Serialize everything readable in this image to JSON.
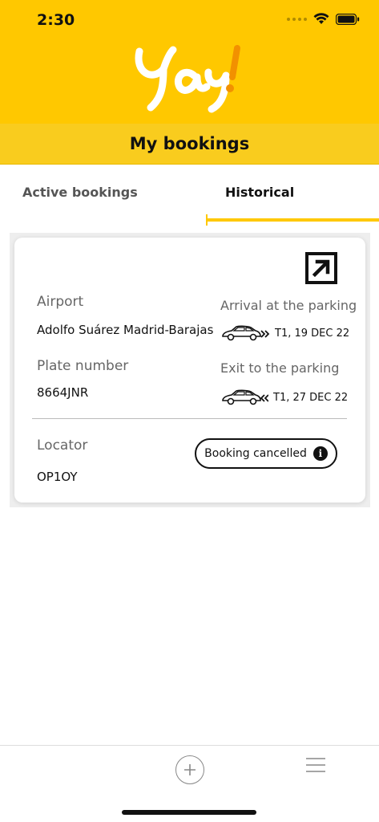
{
  "status_bar": {
    "time": "2:30"
  },
  "brand": {
    "name": "Yay!",
    "accent_color": "#FFC800"
  },
  "header": {
    "title": "My bookings"
  },
  "tabs": [
    {
      "label": "Active bookings",
      "selected": false
    },
    {
      "label": "Historical",
      "selected": true
    }
  ],
  "booking": {
    "airport_label": "Airport",
    "airport_value": "Adolfo Suárez Madrid-Barajas",
    "plate_label": "Plate number",
    "plate_value": "8664JNR",
    "locator_label": "Locator",
    "locator_value": "OP1OY",
    "arrival_label": "Arrival at the parking",
    "arrival_value": "T1, 19 DEC 22",
    "exit_label": "Exit to the parking",
    "exit_value": "T1, 27 DEC 22",
    "status": "Booking cancelled"
  },
  "icons": {
    "open": "external-link-icon",
    "info": "info-icon",
    "add": "plus-circle-icon",
    "menu": "hamburger-menu-icon",
    "car": "car-icon"
  }
}
